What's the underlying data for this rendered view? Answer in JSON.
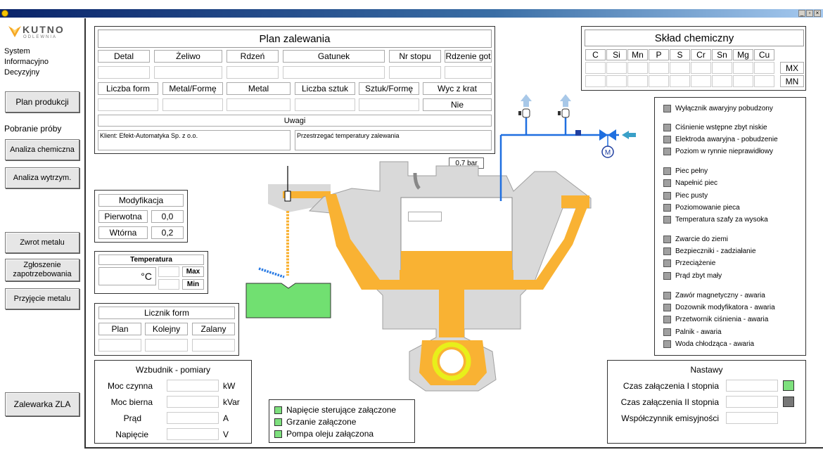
{
  "window": {
    "controls": [
      "_",
      "▫",
      "×"
    ]
  },
  "sidebar": {
    "logo_brand": "KUTNO",
    "logo_sub": "ODLEWNIA",
    "system_title": [
      "System",
      "Informacyjno",
      "Decyzyjny"
    ],
    "plan_btn": "Plan produkcji",
    "pobranie_title": "Pobranie próby",
    "chem_btn": "Analiza chemiczna",
    "wytrzym_btn": "Analiza wytrzym.",
    "zwrot_btn": "Zwrot metalu",
    "zgloszenie_btn": [
      "Zgłoszenie",
      "zapotrzebowania"
    ],
    "przyjecie_btn": "Przyjęcie metalu",
    "zalewarka_btn": "Zalewarka ZLA"
  },
  "plan": {
    "title": "Plan zalewania",
    "headers1": [
      "Detal",
      "Żeliwo",
      "Rdzeń",
      "Gatunek",
      "Nr stopu",
      "Rdzenie got"
    ],
    "headers2": [
      "Liczba form",
      "Metal/Formę",
      "Metal",
      "Liczba sztuk",
      "Sztuk/Formę",
      "Wyc z krat"
    ],
    "wyc_value": "Nie",
    "uwagi_title": "Uwagi",
    "uwagi_left": "Klient: Efekt-Automatyka Sp. z o.o.",
    "uwagi_right": "Przestrzegać temperatury zalewania"
  },
  "sklad": {
    "title": "Skład chemiczny",
    "elements": [
      "C",
      "Si",
      "Mn",
      "P",
      "S",
      "Cr",
      "Sn",
      "Mg",
      "Cu"
    ],
    "mx": "MX",
    "mn": "MN"
  },
  "modyfikacja": {
    "title": "Modyfikacja",
    "pierwotna_label": "Pierwotna",
    "pierwotna_value": "0,0",
    "wtorna_label": "Wtórna",
    "wtorna_value": "0,2"
  },
  "temperatura": {
    "title": "Temperatura",
    "unit": "°C",
    "max": "Max",
    "min": "Min"
  },
  "licznik": {
    "title": "Licznik form",
    "plan": "Plan",
    "kolejny": "Kolejny",
    "zalany": "Zalany"
  },
  "wzbudnik": {
    "title": "Wzbudnik - pomiary",
    "rows": [
      {
        "label": "Moc czynna",
        "unit": "kW"
      },
      {
        "label": "Moc bierna",
        "unit": "kVar"
      },
      {
        "label": "Prąd",
        "unit": "A"
      },
      {
        "label": "Napięcie",
        "unit": "V"
      }
    ]
  },
  "status": [
    "Napięcie sterujące załączone",
    "Grzanie załączone",
    "Pompa oleju załączona"
  ],
  "pressure": "0,7 bar",
  "motor": "M",
  "alarms": [
    "Wyłącznik awaryjny pobudzony",
    "Ciśnienie wstępne zbyt niskie",
    "Elektroda awaryjna - pobudzenie",
    "Poziom w rynnie nieprawidłowy",
    "Piec pełny",
    "Napełnić piec",
    "Piec pusty",
    "Poziomowanie pieca",
    "Temperatura szafy za wysoka",
    "Zwarcie do ziemi",
    "Bezpieczniki - zadziałanie",
    "Przeciążenie",
    "Prąd zbyt mały",
    "Zawór magnetyczny - awaria",
    "Dozownik modyfikatora - awaria",
    "Przetwornik ciśnienia - awaria",
    "Palnik - awaria",
    "Woda chłodząca - awaria"
  ],
  "nastawy": {
    "title": "Nastawy",
    "row1": "Czas załączenia I stopnia",
    "row2": "Czas załączenia II stopnia",
    "row3": "Współczynnik emisyjności"
  },
  "colors": {
    "metal": "#f9b233",
    "furnace": "#d9d9d9",
    "pipe": "#1f6fe0",
    "status_on": "#7de07d",
    "status_off": "#777777"
  }
}
